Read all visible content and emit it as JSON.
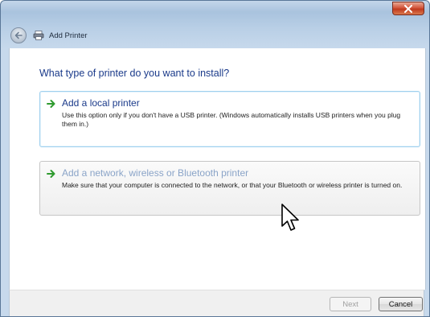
{
  "window": {
    "title": "Add Printer"
  },
  "header": {
    "back_icon": "back-arrow-icon",
    "app_icon": "printer-icon"
  },
  "main": {
    "question": "What type of printer do you want to install?",
    "options": [
      {
        "title": "Add a local printer",
        "description": "Use this option only if you don't have a USB printer. (Windows automatically installs USB printers when you plug them in.)",
        "icon": "green-arrow-icon"
      },
      {
        "title": "Add a network, wireless or Bluetooth printer",
        "description": "Make sure that your computer is connected to the network, or that your Bluetooth or wireless printer is turned on.",
        "icon": "green-arrow-icon"
      }
    ]
  },
  "footer": {
    "next_label": "Next",
    "cancel_label": "Cancel"
  },
  "colors": {
    "link_blue": "#1a3a8a",
    "hover_blue": "#8aa4c8",
    "arrow_green": "#2f9b2f"
  }
}
